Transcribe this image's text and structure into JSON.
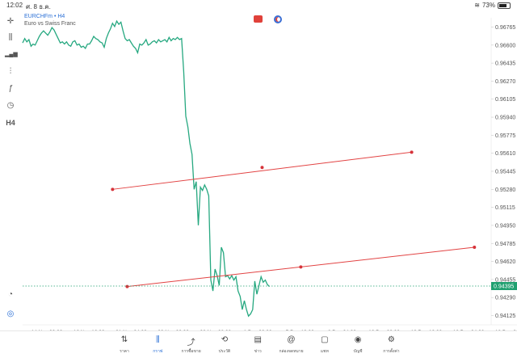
{
  "status_bar": {
    "time": "12:02",
    "date": "ศ. 8 ธ.ค.",
    "battery": "73%",
    "battery_level": 0.73
  },
  "symbol": {
    "name": "EURCHFm • H4",
    "description": "Euro vs Swiss Franc"
  },
  "left_toolbar": [
    {
      "name": "crosshair-icon",
      "glyph": "+"
    },
    {
      "name": "candles-icon",
      "glyph": "⫼"
    },
    {
      "name": "bars-icon",
      "glyph": "▂▄▆"
    },
    {
      "name": "objects-icon",
      "glyph": "⫶"
    },
    {
      "name": "indicator-icon",
      "glyph": "ƒ"
    },
    {
      "name": "shapes-icon",
      "glyph": "◷"
    },
    {
      "name": "timeframe-label",
      "glyph": "H4"
    }
  ],
  "chart_data": {
    "type": "line",
    "series": [
      {
        "values": [
          0.9662,
          0.9666,
          0.9663,
          0.9665,
          0.9659,
          0.9661,
          0.966,
          0.9664,
          0.9668,
          0.9671,
          0.9673,
          0.9671,
          0.9669,
          0.9672,
          0.9676,
          0.9674,
          0.967,
          0.9666,
          0.9662,
          0.9663,
          0.9661,
          0.9663,
          0.966,
          0.9659,
          0.9663,
          0.9664,
          0.966,
          0.9661,
          0.9658,
          0.9659,
          0.9657,
          0.9661,
          0.9661,
          0.9664,
          0.9668,
          0.9666,
          0.9665,
          0.9663,
          0.9662,
          0.9658,
          0.9666,
          0.9671,
          0.9675,
          0.968,
          0.9677,
          0.9682,
          0.9679,
          0.9681,
          0.9673,
          0.9666,
          0.9664,
          0.9665,
          0.9662,
          0.9659,
          0.9657,
          0.9653,
          0.9661,
          0.966,
          0.9662,
          0.9665,
          0.966,
          0.9661,
          0.9663,
          0.9664,
          0.9662,
          0.9665,
          0.9663,
          0.9664,
          0.9665,
          0.9663,
          0.9667,
          0.9664,
          0.9666,
          0.9665,
          0.9667,
          0.9665,
          0.9666,
          0.9636,
          0.9595,
          0.9585,
          0.957,
          0.956,
          0.9528,
          0.9535,
          0.9495,
          0.953,
          0.9527,
          0.9532,
          0.9528,
          0.9522,
          0.9445,
          0.9435,
          0.9455,
          0.9449,
          0.944,
          0.9475,
          0.947,
          0.9448,
          0.9449,
          0.9446,
          0.9449,
          0.9445,
          0.9448,
          0.9435,
          0.943,
          0.9418,
          0.9426,
          0.9418,
          0.9412,
          0.9414,
          0.9418,
          0.9444,
          0.9432,
          0.944,
          0.9448,
          0.9443,
          0.9445,
          0.9441,
          0.9439
        ]
      }
    ],
    "y_axis": {
      "ticks": [
        "0.96765",
        "0.96600",
        "0.96435",
        "0.96270",
        "0.96105",
        "0.95940",
        "0.95775",
        "0.95610",
        "0.95445",
        "0.95280",
        "0.95115",
        "0.94950",
        "0.94785",
        "0.94620",
        "0.94455",
        "0.94290",
        "0.94125"
      ],
      "ylim": [
        0.9404,
        0.9685
      ]
    },
    "x_axis": {
      "ticks": [
        "14 Nov 00:00",
        "16 Nov 16:00",
        "21 Nov 04:00",
        "23 Nov 20:00",
        "28 Nov 08:00",
        "1 Dec 00:00",
        "5 Dec 12:00",
        "8 Dec 04:00",
        "10 Dec 20:00",
        "13 Dec 12:00",
        "16 Dec 04:00",
        "18 Dec 20:00"
      ]
    },
    "current_price": "0.94395",
    "trend_lines": [
      {
        "from": [
          43,
          0.9528
        ],
        "to": [
          186,
          0.9562
        ],
        "mid": [
          114.5,
          0.9548
        ]
      },
      {
        "from": [
          50,
          0.9439
        ],
        "to": [
          216,
          0.9475
        ],
        "mid": [
          133,
          0.9457
        ]
      }
    ],
    "x_total": 224,
    "line_color": "#26a880",
    "trendline_color": "#e24343",
    "price_label_bg": "#20a070"
  },
  "tab_bar": [
    {
      "label": "ราคา",
      "icon": "⇅",
      "name": "tab-quotes"
    },
    {
      "label": "กราฟ",
      "icon": "⫼",
      "name": "tab-chart",
      "active": true
    },
    {
      "label": "การซื้อขาย",
      "icon": "⤴",
      "name": "tab-trade"
    },
    {
      "label": "ประวัติ",
      "icon": "⟲",
      "name": "tab-history"
    },
    {
      "label": "ข่าว",
      "icon": "▤",
      "name": "tab-news"
    },
    {
      "label": "กล่องจดหมาย",
      "icon": "@",
      "name": "tab-mailbox"
    },
    {
      "label": "แชท",
      "icon": "▢",
      "name": "tab-chat"
    },
    {
      "label": "บัญชี",
      "icon": "◉",
      "name": "tab-accounts"
    },
    {
      "label": "การตั้งค่า",
      "icon": "⚙",
      "name": "tab-settings"
    }
  ]
}
